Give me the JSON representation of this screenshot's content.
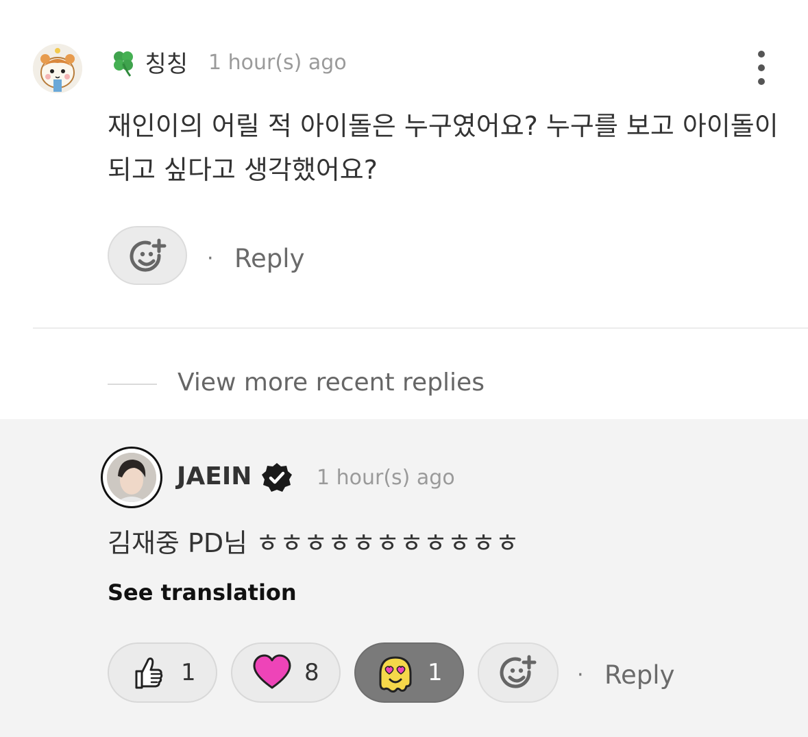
{
  "comment": {
    "author": "칭칭",
    "author_prefix_icon": "four-leaf-clover-icon",
    "time": "1 hour(s) ago",
    "text": "재인이의 어릴 적 아이돌은 누구였어요? 누구를 보고 아이돌이 되고 싶다고 생각했어요?",
    "reply_label": "Reply",
    "separator": "·"
  },
  "more_replies_label": "View more recent replies",
  "reply": {
    "author": "JAEIN",
    "verified_icon": "verified-badge-icon",
    "time": "1 hour(s) ago",
    "text": "김재중 PD님 ㅎㅎㅎㅎㅎㅎㅎㅎㅎㅎㅎ",
    "translate_label": "See translation",
    "reactions": [
      {
        "icon": "thumbs-up-icon",
        "count": "1"
      },
      {
        "icon": "heart-icon",
        "count": "8",
        "color": "#ee44b8"
      },
      {
        "icon": "melting-heart-eyes-icon",
        "count": "1",
        "color": "#f5d84a"
      }
    ],
    "reply_label": "Reply",
    "separator": "·"
  },
  "colors": {
    "reply_area_bg": "#f3f3f3",
    "active_reaction_bg": "#7a7a7a",
    "heart": "#ee44b8"
  }
}
